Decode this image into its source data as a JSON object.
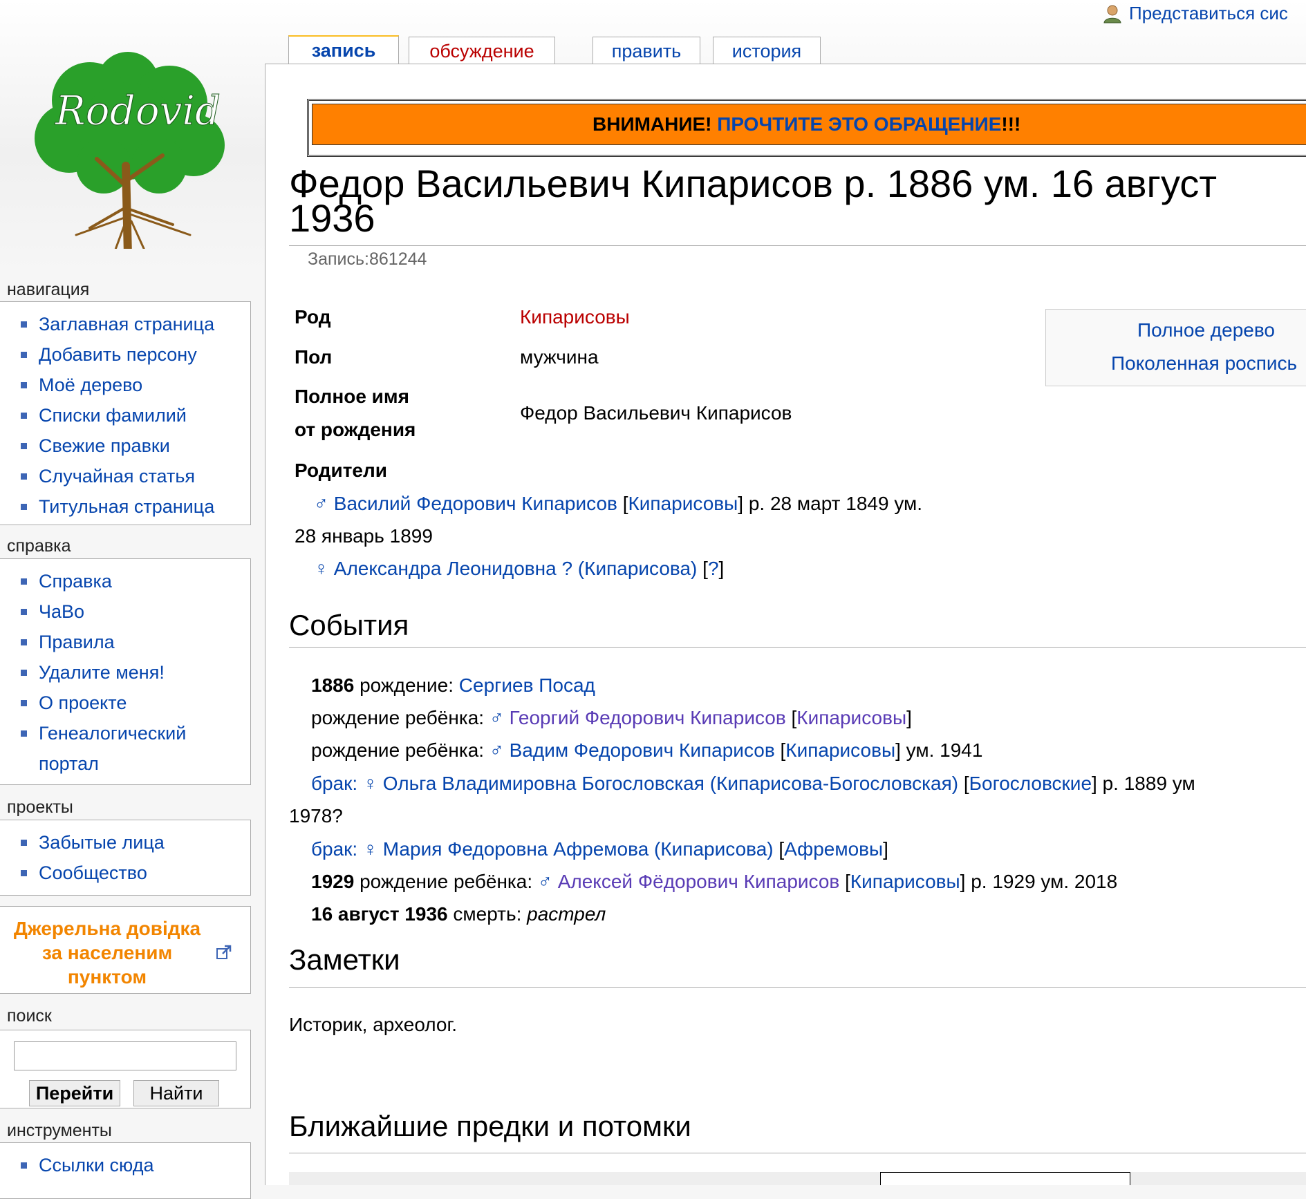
{
  "personal": {
    "login_label": "Представиться сис"
  },
  "logo": {
    "text": "Rodovid"
  },
  "tabs": [
    {
      "label": "запись",
      "selected": true
    },
    {
      "label": "обсуждение",
      "selected": false
    },
    {
      "label": "править",
      "selected": false
    },
    {
      "label": "история",
      "selected": false
    }
  ],
  "sitenotice": {
    "prefix": "ВНИМАНИЕ!",
    "link": "ПРОЧТИТЕ ЭТО ОБРАЩЕНИЕ",
    "suffix": "!!!"
  },
  "page": {
    "title": "Федор Васильевич Кипарисов р. 1886 ум. 16 август 1936",
    "record_id": "Запись:861244"
  },
  "info": {
    "rod_label": "Род",
    "rod_value": "Кипарисовы",
    "pol_label": "Пол",
    "pol_value": "мужчина",
    "fullname_label_1": "Полное имя",
    "fullname_label_2": "от рождения",
    "fullname_value": "Федор Васильевич Кипарисов",
    "parents_label": "Родители"
  },
  "tree_links": {
    "full_tree": "Полное дерево",
    "generations": "Поколенная роспись"
  },
  "parents": {
    "father": {
      "symbol": "♂",
      "name": "Василий Федорович Кипарисов",
      "clan": "Кипарисовы",
      "dates_1": "р. 28 март 1849 ум.",
      "dates_2": "28 январь 1899"
    },
    "mother": {
      "symbol": "♀",
      "name": "Александра Леонидовна ? (Кипарисова)",
      "clan": "?"
    }
  },
  "events_heading": "События",
  "events": {
    "e1": {
      "year": "1886",
      "type": "рождение:",
      "place": "Сергиев Посад"
    },
    "e2": {
      "type": "рождение ребёнка:",
      "symbol": "♂",
      "name": "Георгий Федорович Кипарисов",
      "clan": "Кипарисовы"
    },
    "e3": {
      "type": "рождение ребёнка:",
      "symbol": "♂",
      "name": "Вадим Федорович Кипарисов",
      "clan": "Кипарисовы",
      "dates": "ум. 1941"
    },
    "e4": {
      "type": "брак:",
      "symbol": "♀",
      "name": "Ольга Владимировна Богословская (Кипарисова-Богословская)",
      "clan": "Богословские",
      "dates": "р. 1889 ум",
      "dates_2": "1978?"
    },
    "e5": {
      "type": "брак:",
      "symbol": "♀",
      "name": "Мария Федоровна Афремова (Кипарисова)",
      "clan": "Афремовы"
    },
    "e6": {
      "year": "1929",
      "type": "рождение ребёнка:",
      "symbol": "♂",
      "name": "Алексей Фёдорович Кипарисов",
      "clan": "Кипарисовы",
      "dates": "р. 1929 ум. 2018"
    },
    "e7": {
      "year": "16 август 1936",
      "type": "смерть:",
      "note": "растрел"
    }
  },
  "notes_heading": "Заметки",
  "notes_text": "Историк, археолог.",
  "relatives_heading": "Ближайшие предки и потомки",
  "sidebar": {
    "navigation": {
      "heading": "навигация",
      "items": [
        "Заглавная страница",
        "Добавить персону",
        "Моё дерево",
        "Списки фамилий",
        "Свежие правки",
        "Случайная статья",
        "Титульная страница"
      ]
    },
    "help": {
      "heading": "справка",
      "items": [
        "Справка",
        "ЧаВо",
        "Правила",
        "Удалите меня!",
        "О проекте",
        "Генеалогический",
        "портал"
      ]
    },
    "projects": {
      "heading": "проекты",
      "items": [
        "Забытые лица",
        "Сообщество"
      ]
    },
    "source": {
      "line1": "Джерельна довідка",
      "line2": "за населеним",
      "line3": "пунктом"
    },
    "search": {
      "heading": "поиск",
      "go_label": "Перейти",
      "search_label": "Найти",
      "placeholder": ""
    },
    "tools": {
      "heading": "инструменты",
      "items": [
        "Ссылки сюда"
      ]
    }
  }
}
